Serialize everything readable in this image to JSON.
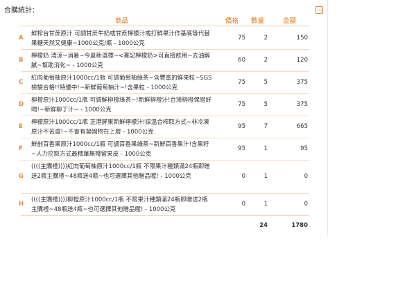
{
  "section": {
    "title": "合購統計：",
    "collapse_symbol": "−"
  },
  "table": {
    "headers": {
      "product": "商品",
      "price": "價格",
      "qty": "數量",
      "amount": "金額"
    },
    "rows": [
      {
        "letter": "A",
        "name": "鮮榨台甘蔗原汁 可調甘蔗牛奶或甘蔗檸檬汁或打鮮果汁作基底等代替果糖天然又健康~1000公克/瓶 - 1000公克",
        "price": "75",
        "qty": "2",
        "amount": "150"
      },
      {
        "letter": "B",
        "name": "檸檬奶 清涼~消暑~今夏新選擇~<寡記檸檬奶>可直接飲用~去油解膩~幫助消化~ - 1000公克",
        "price": "60",
        "qty": "2",
        "amount": "120"
      },
      {
        "letter": "C",
        "name": "紅肉葡萄柚原汁1000cc/1瓶 可調葡萄柚綠茶~含豐富的鮮果粒~SGS檢驗合格!!特優中!~新鮮葡萄柚汁~!含果粒 - 1000公克",
        "price": "75",
        "qty": "5",
        "amount": "375"
      },
      {
        "letter": "D",
        "name": "柳橙原汁1000cc/1瓶 可調鮮柳橙綠茶~!新鮮柳橙汁!台灣柳橙保證好喝!~新鮮柳丁汁~ - 1000公克",
        "price": "75",
        "qty": "5",
        "amount": "375"
      },
      {
        "letter": "E",
        "name": "檸檬原汁1000cc/1瓶 正港屏東新鮮檸檬汁!採溫合榨取方式~非冷凍原汁不苦澀!~不會有凝固物在上層 - 1000公克",
        "price": "95",
        "qty": "7",
        "amount": "665"
      },
      {
        "letter": "F",
        "name": "鮮剖百香果原汁1000cc/1瓶 可調百香果綠茶~新鮮百香果汁!含果籽~人力挖取方式最精華無殘留果皮 - 1000公克",
        "price": "95",
        "qty": "1",
        "amount": "95"
      },
      {
        "letter": "G",
        "name": "((((主購禮))))紅肉葡萄柚原汁1000cc/1瓶 不限果汁種類滿24瓶即贈送2瓶主購禮~48瓶送4瓶~也可選擇其他贈品喔! - 1000公克",
        "price": "0",
        "qty": "1",
        "amount": "0"
      },
      {
        "letter": "H",
        "name": "((((主購禮))))柳橙原汁1000cc/1瓶 不限果汁種類滿24瓶即贈送2瓶主購禮~48瓶送4瓶~也可選擇其他贈品喔! - 1000公克",
        "price": "0",
        "qty": "1",
        "amount": "0"
      }
    ],
    "totals": {
      "qty": "24",
      "amount": "1780"
    }
  }
}
